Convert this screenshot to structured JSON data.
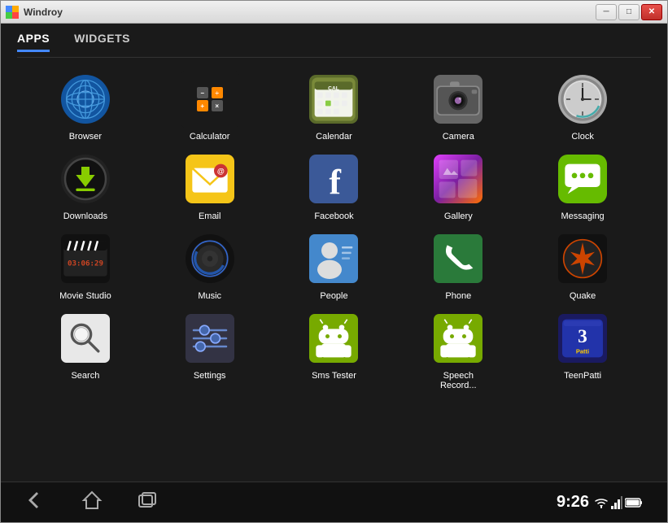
{
  "window": {
    "title": "Windroy",
    "controls": {
      "minimize": "─",
      "maximize": "□",
      "close": "✕"
    }
  },
  "tabs": {
    "apps_label": "APPS",
    "widgets_label": "WIDGETS",
    "active": "apps"
  },
  "apps": [
    {
      "id": "browser",
      "label": "Browser",
      "icon_type": "browser"
    },
    {
      "id": "calculator",
      "label": "Calculator",
      "icon_type": "calculator"
    },
    {
      "id": "calendar",
      "label": "Calendar",
      "icon_type": "calendar"
    },
    {
      "id": "camera",
      "label": "Camera",
      "icon_type": "camera"
    },
    {
      "id": "clock",
      "label": "Clock",
      "icon_type": "clock"
    },
    {
      "id": "downloads",
      "label": "Downloads",
      "icon_type": "downloads"
    },
    {
      "id": "email",
      "label": "Email",
      "icon_type": "email"
    },
    {
      "id": "facebook",
      "label": "Facebook",
      "icon_type": "facebook"
    },
    {
      "id": "gallery",
      "label": "Gallery",
      "icon_type": "gallery"
    },
    {
      "id": "messaging",
      "label": "Messaging",
      "icon_type": "messaging"
    },
    {
      "id": "moviestudio",
      "label": "Movie Studio",
      "icon_type": "moviestudio"
    },
    {
      "id": "music",
      "label": "Music",
      "icon_type": "music"
    },
    {
      "id": "people",
      "label": "People",
      "icon_type": "people"
    },
    {
      "id": "phone",
      "label": "Phone",
      "icon_type": "phone"
    },
    {
      "id": "quake",
      "label": "Quake",
      "icon_type": "quake"
    },
    {
      "id": "search",
      "label": "Search",
      "icon_type": "search"
    },
    {
      "id": "settings",
      "label": "Settings",
      "icon_type": "settings"
    },
    {
      "id": "smstester",
      "label": "Sms Tester",
      "icon_type": "smstester"
    },
    {
      "id": "speechrecord",
      "label": "Speech Record...",
      "icon_type": "speechrecord"
    },
    {
      "id": "teenpatti",
      "label": "TeenPatti",
      "icon_type": "teenpatti"
    }
  ],
  "bottom_bar": {
    "back_symbol": "◁",
    "home_symbol": "△",
    "recents_symbol": "▭",
    "time": "9:26",
    "wifi_symbol": "▾",
    "signal_symbol": "▲",
    "battery_symbol": "▮"
  }
}
